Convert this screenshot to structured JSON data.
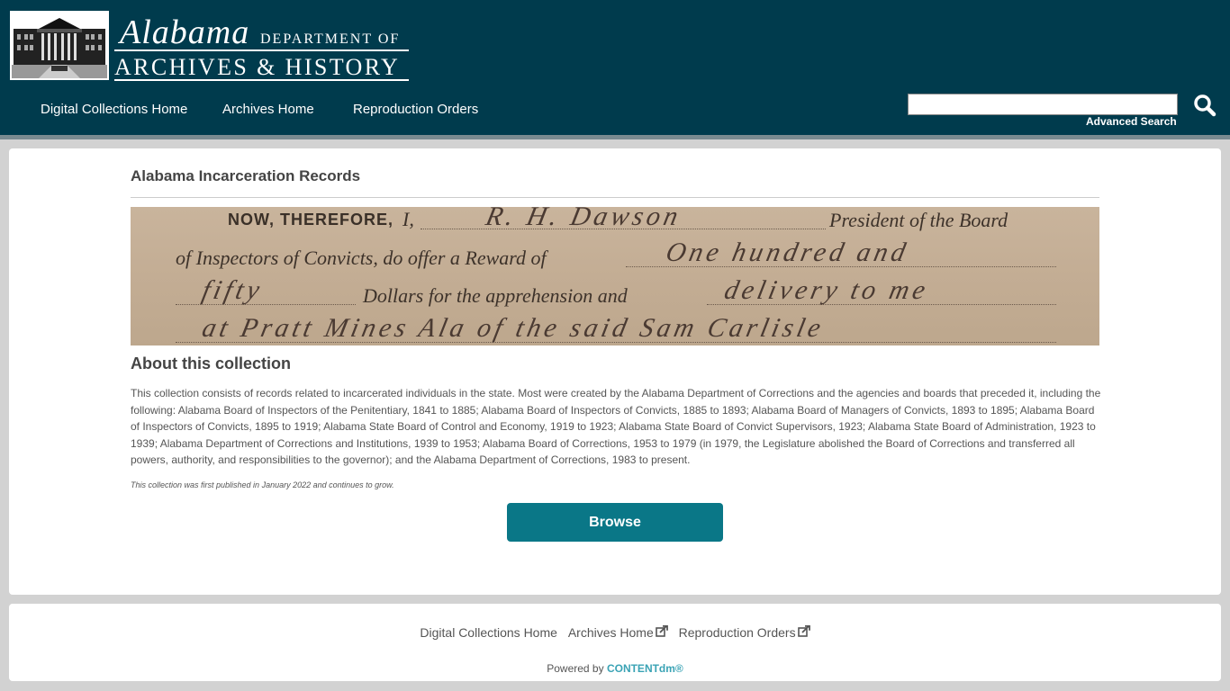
{
  "header": {
    "logo": {
      "script": "Alabama",
      "department": "DEPARTMENT OF",
      "archives": "ARCHIVES & HISTORY"
    },
    "nav": [
      "Digital Collections Home",
      "Archives Home",
      "Reproduction Orders"
    ],
    "search": {
      "value": "",
      "placeholder": "",
      "advanced_label": "Advanced Search",
      "icon": "search-icon"
    }
  },
  "main": {
    "title": "Alabama Incarceration Records",
    "banner": {
      "line1_caps": "NOW, THEREFORE,",
      "line1_i": "I,",
      "line1_hand": "R. H. Dawson",
      "line1_print": "President of the Board",
      "line2_print": "of Inspectors of Convicts, do offer a Reward of",
      "line2_hand": "One hundred and",
      "line3_hand1": "fifty",
      "line3_print": "Dollars for the apprehension and",
      "line3_hand2": "delivery to me",
      "line4_hand": "at Pratt Mines Ala of the said Sam Carlisle"
    },
    "about_heading": "About this collection",
    "about_text": "This collection consists of records related to incarcerated individuals in the state. Most were created by the Alabama Department of Corrections and the agencies and boards that preceded it, including the following: Alabama Board of Inspectors of the Penitentiary, 1841 to 1885; Alabama Board of Inspectors of Convicts, 1885 to 1893; Alabama Board of Managers of Convicts, 1893 to 1895; Alabama Board of Inspectors of Convicts, 1895 to 1919; Alabama State Board of Control and Economy, 1919 to 1923; Alabama State Board of Convict Supervisors, 1923; Alabama State Board of Administration, 1923 to 1939; Alabama Department of Corrections and Institutions, 1939 to 1953; Alabama Board of Corrections, 1953 to 1979 (in 1979, the Legislature abolished the Board of Corrections and transferred all powers, authority, and responsibilities to the governor); and the Alabama Department of Corrections, 1983 to present.",
    "publish_note": "This collection was first published in January 2022 and continues to grow.",
    "browse_label": "Browse"
  },
  "footer": {
    "links": [
      "Digital Collections Home",
      "Archives Home",
      "Reproduction Orders"
    ],
    "powered_by": "Powered by",
    "cdm": "CONTENTdm®"
  },
  "colors": {
    "header_bg": "#003b4d",
    "accent": "#0a7787",
    "link_accent": "#3aa3b5",
    "page_bg": "#d2d2d2"
  }
}
